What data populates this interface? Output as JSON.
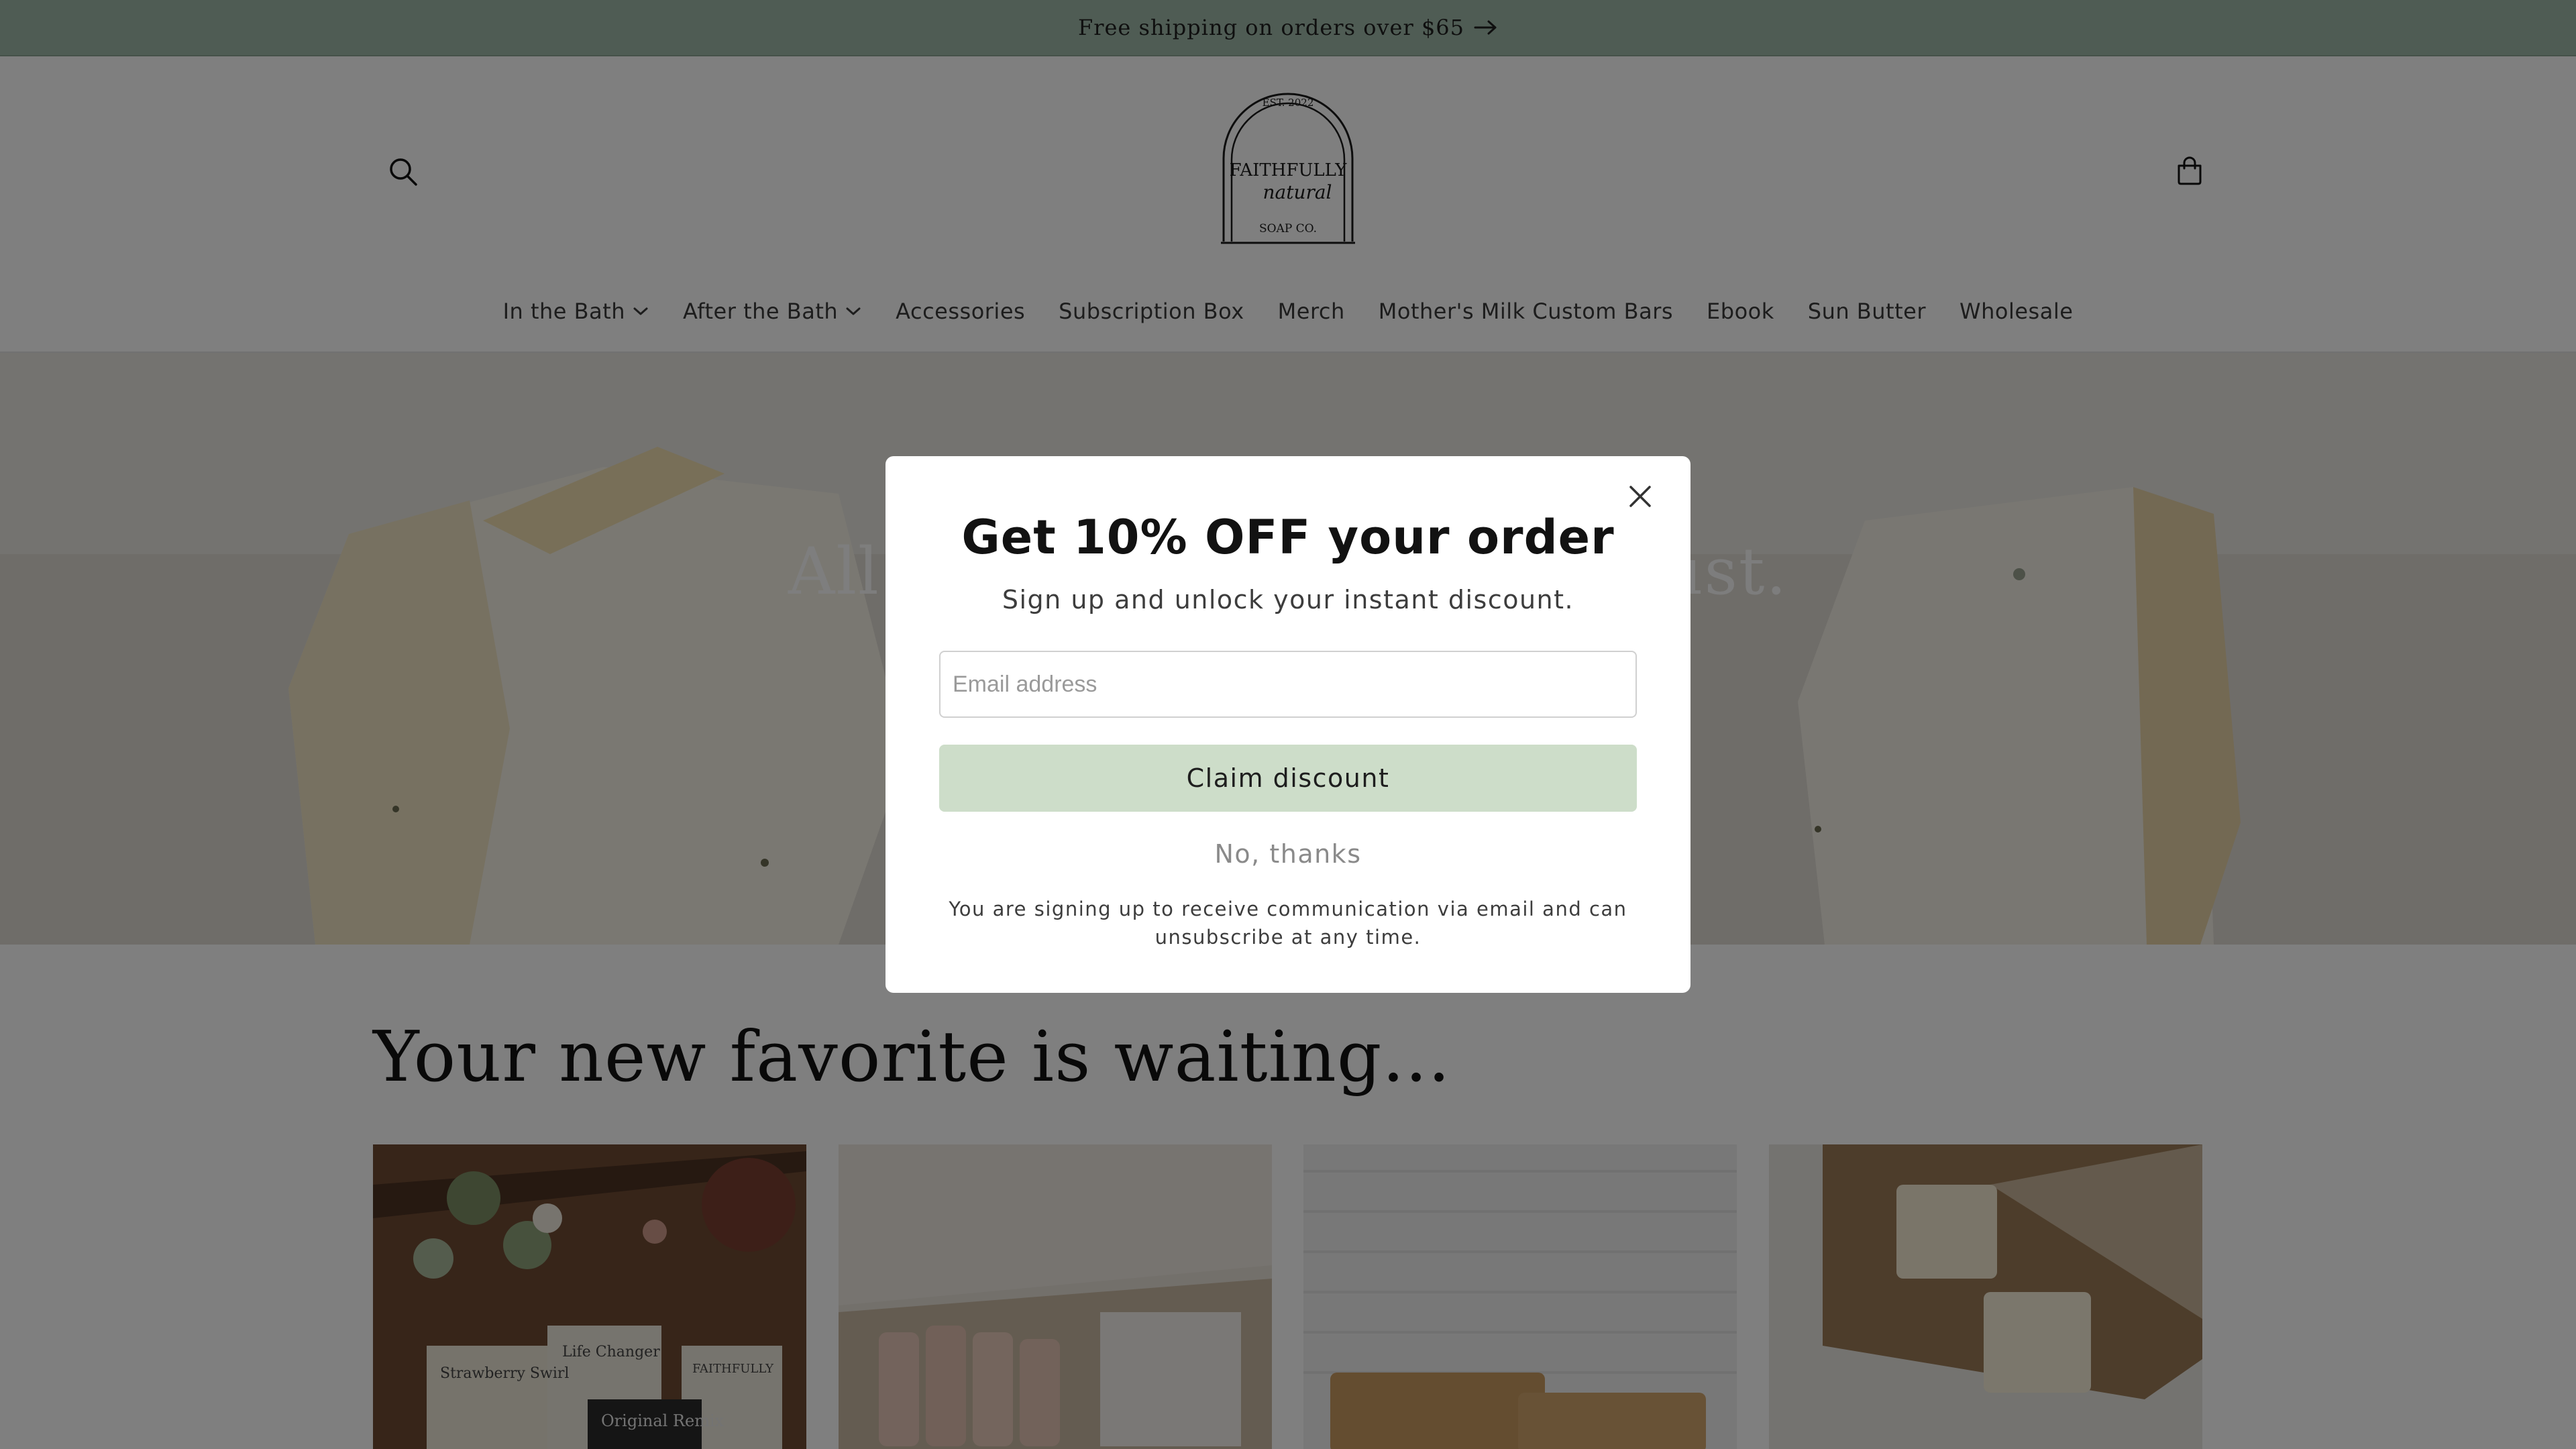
{
  "announcement": {
    "text": "Free shipping on orders over $65",
    "icon": "arrow-right-icon"
  },
  "header": {
    "logo": {
      "est": "EST. 2022",
      "line1": "FAITHFULLY",
      "line2": "natural",
      "line3": "SOAP CO."
    },
    "search_icon": "search-icon",
    "cart_icon": "cart-icon"
  },
  "nav": [
    {
      "label": "In the Bath",
      "has_dropdown": true
    },
    {
      "label": "After the Bath",
      "has_dropdown": true
    },
    {
      "label": "Accessories",
      "has_dropdown": false
    },
    {
      "label": "Subscription Box",
      "has_dropdown": false
    },
    {
      "label": "Merch",
      "has_dropdown": false
    },
    {
      "label": "Mother's Milk Custom Bars",
      "has_dropdown": false
    },
    {
      "label": "Ebook",
      "has_dropdown": false
    },
    {
      "label": "Sun Butter",
      "has_dropdown": false
    },
    {
      "label": "Wholesale",
      "has_dropdown": false
    }
  ],
  "hero": {
    "heading_left": "All",
    "heading_right": "ust."
  },
  "collection": {
    "title": "Your new favorite is waiting...",
    "product_labels": [
      "Strawberry Swirl",
      "Life Changer",
      "Original Remix",
      "FAITHFULLY"
    ]
  },
  "popup": {
    "title": "Get 10% OFF your order",
    "subtitle": "Sign up and unlock your instant discount.",
    "email_placeholder": "Email address",
    "claim_label": "Claim discount",
    "decline_label": "No, thanks",
    "disclaimer": "You are signing up to receive communication via email and can unsubscribe at any time.",
    "close_icon": "close-icon"
  },
  "colors": {
    "announcement_bg": "#9fb9a8",
    "claim_button": "#cdddc9",
    "overlay": "rgba(0,0,0,0.5)"
  }
}
